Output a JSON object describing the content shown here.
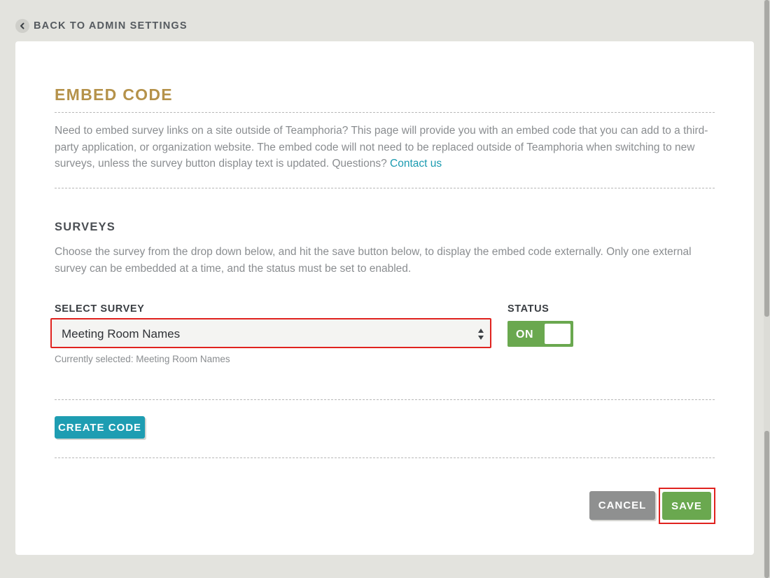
{
  "nav": {
    "back_label": "BACK TO ADMIN SETTINGS",
    "back_icon": "chevron-left-icon"
  },
  "header": {
    "title": "EMBED CODE",
    "intro_text": "Need to embed survey links on a site outside of Teamphoria? This page will provide you with an embed code that you can add to a third-party application, or organization website. The embed code will not need to be replaced outside of Teamphoria when switching to new surveys, unless the survey button display text is updated. Questions? ",
    "contact_link": "Contact us"
  },
  "surveys": {
    "title": "SURVEYS",
    "description": "Choose the survey from the drop down below, and hit the save button below, to display the embed code externally. Only one external survey can be embedded at a time, and the status must be set to enabled.",
    "select_label": "SELECT SURVEY",
    "selected_value": "Meeting Room Names",
    "helper_text": "Currently selected: Meeting Room Names",
    "status_label": "STATUS",
    "status_value": "ON"
  },
  "actions": {
    "create_code": "CREATE CODE",
    "cancel": "CANCEL",
    "save": "SAVE"
  },
  "colors": {
    "title_gold": "#b5924a",
    "link_teal": "#1a9ab0",
    "toggle_green": "#6aa84f",
    "create_teal": "#1e9db2",
    "cancel_gray": "#8f9090",
    "highlight_red": "#e0231f"
  }
}
